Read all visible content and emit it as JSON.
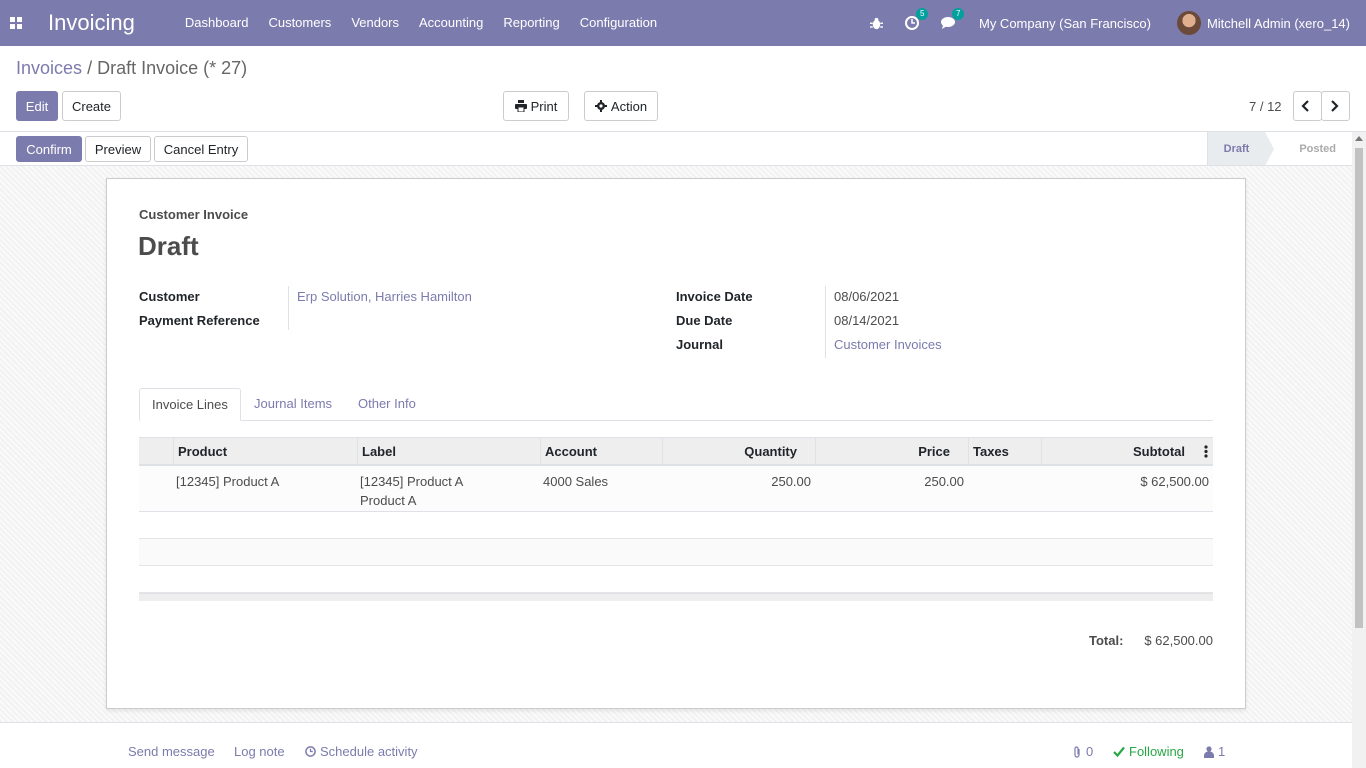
{
  "navbar": {
    "brand": "Invoicing",
    "menu": [
      "Dashboard",
      "Customers",
      "Vendors",
      "Accounting",
      "Reporting",
      "Configuration"
    ],
    "activity_count": "5",
    "message_count": "7",
    "company": "My Company (San Francisco)",
    "user": "Mitchell Admin (xero_14)",
    "bg_color": "#7c7bad"
  },
  "breadcrumb": {
    "parent": "Invoices",
    "separator": "/",
    "current": "Draft Invoice (* 27)"
  },
  "toolbar": {
    "edit": "Edit",
    "create": "Create",
    "print": "Print",
    "action": "Action",
    "pager": "7 / 12"
  },
  "statusbar": {
    "confirm": "Confirm",
    "preview": "Preview",
    "cancel_entry": "Cancel Entry",
    "stages": [
      "Draft",
      "Posted"
    ],
    "active_stage": "Draft"
  },
  "form": {
    "type": "Customer Invoice",
    "state": "Draft",
    "left_fields": {
      "customer_label": "Customer",
      "customer_value": "Erp Solution, Harries Hamilton",
      "payment_ref_label": "Payment Reference",
      "payment_ref_value": ""
    },
    "right_fields": {
      "invoice_date_label": "Invoice Date",
      "invoice_date_value": "08/06/2021",
      "due_date_label": "Due Date",
      "due_date_value": "08/14/2021",
      "journal_label": "Journal",
      "journal_value": "Customer Invoices"
    },
    "tabs": [
      "Invoice Lines",
      "Journal Items",
      "Other Info"
    ],
    "table": {
      "headers": [
        "Product",
        "Label",
        "Account",
        "Quantity",
        "Price",
        "Taxes",
        "Subtotal"
      ],
      "rows": [
        {
          "product": "[12345] Product A",
          "label_line1": "[12345] Product A",
          "label_line2": "Product A",
          "account": "4000 Sales",
          "quantity": "250.00",
          "price": "250.00",
          "taxes": "",
          "subtotal": "$ 62,500.00"
        }
      ]
    },
    "total_label": "Total:",
    "total_value": "$ 62,500.00"
  },
  "chatter": {
    "send_message": "Send message",
    "log_note": "Log note",
    "schedule_activity": "Schedule activity",
    "attachments": "0",
    "following": "Following",
    "followers": "1"
  }
}
